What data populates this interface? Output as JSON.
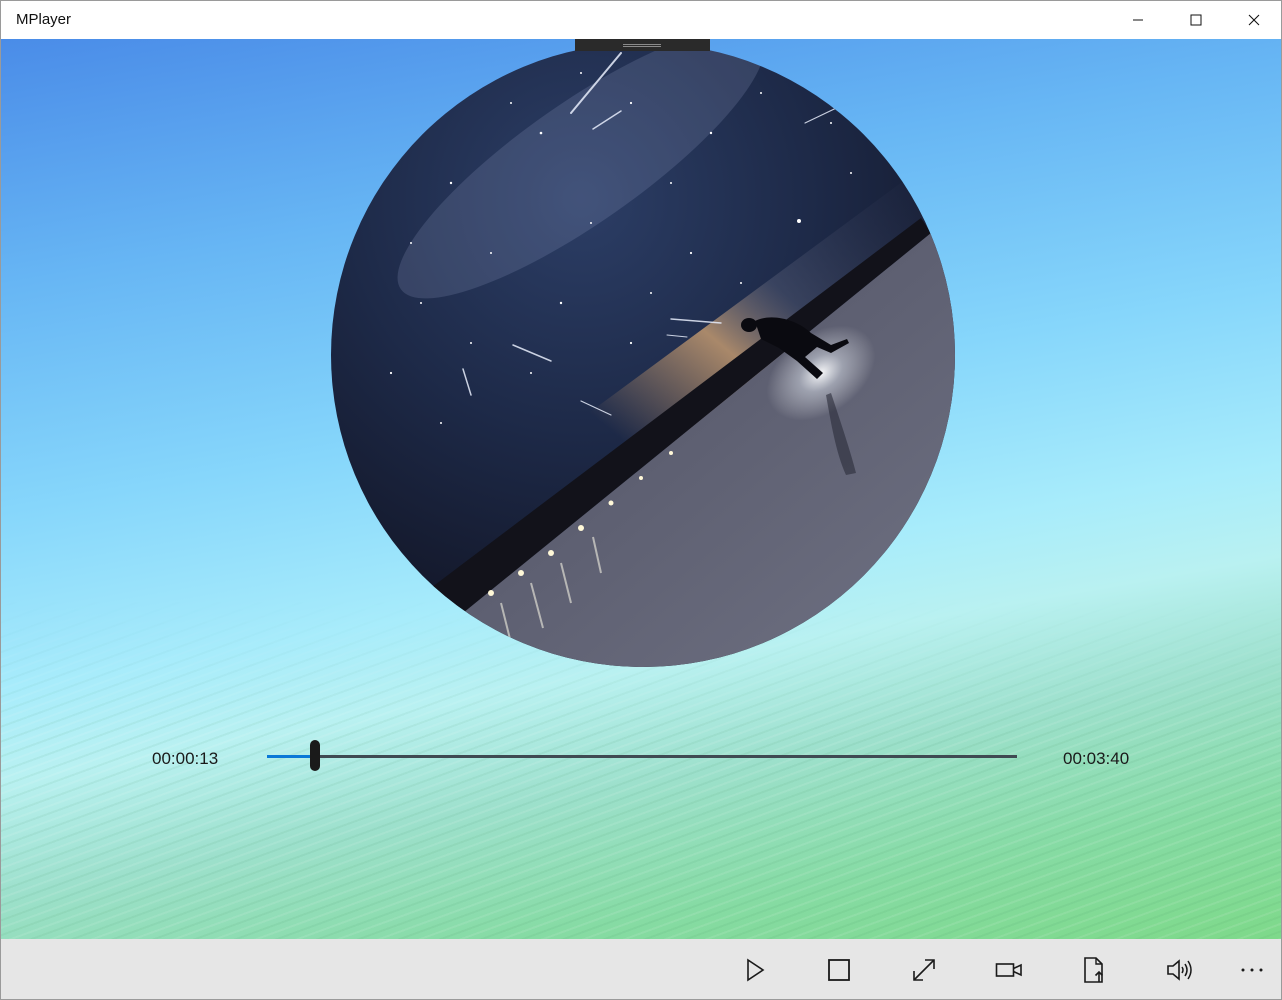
{
  "window": {
    "title": "MPlayer"
  },
  "player": {
    "current_time": "00:00:13",
    "total_time": "00:03:40",
    "progress_fraction": 0.0636
  },
  "toolbar": {
    "buttons": [
      {
        "name": "play-button",
        "icon": "play-icon"
      },
      {
        "name": "stop-button",
        "icon": "stop-icon"
      },
      {
        "name": "fullscreen-button",
        "icon": "expand-icon"
      },
      {
        "name": "video-button",
        "icon": "video-camera-icon"
      },
      {
        "name": "open-file-button",
        "icon": "file-upload-icon"
      },
      {
        "name": "volume-button",
        "icon": "volume-icon"
      },
      {
        "name": "more-button",
        "icon": "more-icon"
      }
    ]
  },
  "colors": {
    "accent": "#0a78d7",
    "command_bar": "#e6e6e6"
  }
}
